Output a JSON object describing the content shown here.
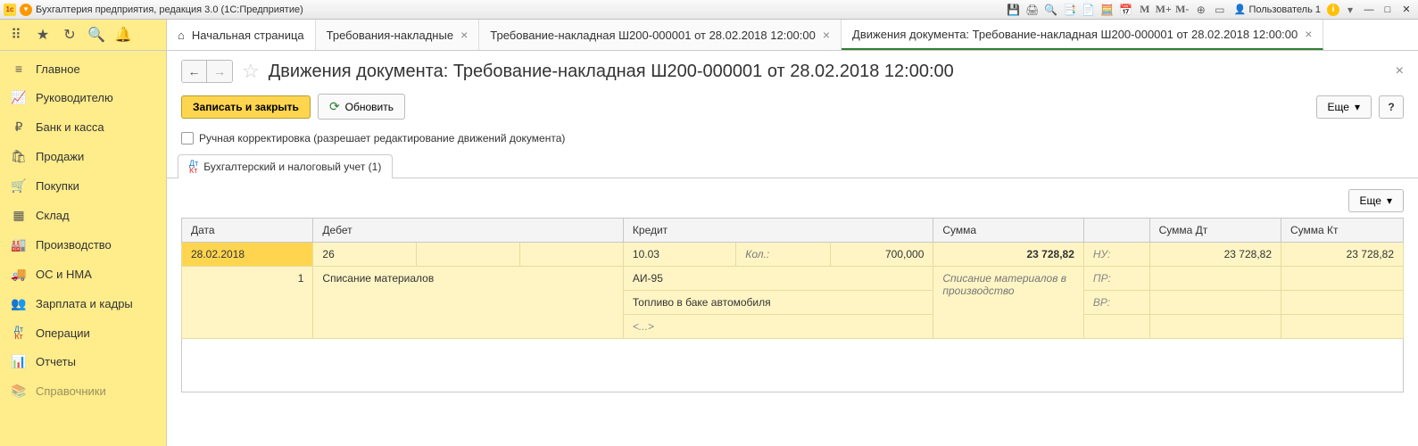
{
  "window_title": "Бухгалтерия предприятия, редакция 3.0  (1С:Предприятие)",
  "user_label": "Пользователь 1",
  "m_buttons": [
    "M",
    "M+",
    "M-"
  ],
  "top_tabs": [
    {
      "label": "Начальная страница",
      "closable": false
    },
    {
      "label": "Требования-накладные",
      "closable": true
    },
    {
      "label": "Требование-накладная Ш200-000001 от 28.02.2018 12:00:00",
      "closable": true
    },
    {
      "label": "Движения документа: Требование-накладная Ш200-000001 от 28.02.2018 12:00:00",
      "closable": true,
      "active": true
    }
  ],
  "sidebar": [
    {
      "label": "Главное",
      "icon": "≡"
    },
    {
      "label": "Руководителю",
      "icon": "📈"
    },
    {
      "label": "Банк и касса",
      "icon": "₽"
    },
    {
      "label": "Продажи",
      "icon": "🛍"
    },
    {
      "label": "Покупки",
      "icon": "🛒"
    },
    {
      "label": "Склад",
      "icon": "▦"
    },
    {
      "label": "Производство",
      "icon": "🏭"
    },
    {
      "label": "ОС и НМА",
      "icon": "🚚"
    },
    {
      "label": "Зарплата и кадры",
      "icon": "👥"
    },
    {
      "label": "Операции",
      "icon": "ДтКт"
    },
    {
      "label": "Отчеты",
      "icon": "📊"
    },
    {
      "label": "Справочники",
      "icon": "📚",
      "dim": true
    }
  ],
  "page": {
    "title": "Движения документа: Требование-накладная Ш200-000001 от 28.02.2018 12:00:00",
    "save_close": "Записать и закрыть",
    "refresh": "Обновить",
    "more": "Еще",
    "help": "?",
    "manual_check_label": "Ручная корректировка (разрешает редактирование движений документа)",
    "doc_tab_label": "Бухгалтерский и налоговый учет (1)"
  },
  "table": {
    "headers": {
      "date": "Дата",
      "debit": "Дебет",
      "credit": "Кредит",
      "sum": "Сумма",
      "sum_dt": "Сумма Дт",
      "sum_kt": "Сумма Кт"
    },
    "row1": {
      "date": "28.02.2018",
      "debit_acc": "26",
      "credit_acc": "10.03",
      "qty_label": "Кол.:",
      "qty": "700,000",
      "sum": "23 728,82",
      "nu_label": "НУ:",
      "sum_dt": "23 728,82",
      "sum_kt": "23 728,82"
    },
    "row2": {
      "line_no": "1",
      "debit_text": "Списание материалов",
      "credit_text1": "АИ-95",
      "credit_text2": "Топливо в баке автомобиля",
      "credit_text3": "<...>",
      "sum_text": "Списание материалов в производство",
      "pr_label": "ПР:",
      "vr_label": "ВР:"
    }
  }
}
